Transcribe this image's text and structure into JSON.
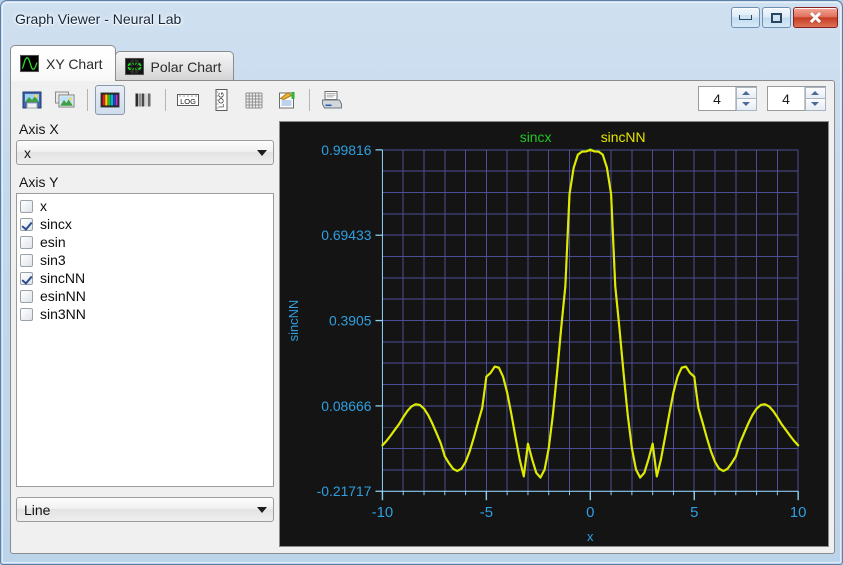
{
  "window": {
    "title": "Graph Viewer - Neural Lab",
    "controls": {
      "minimize": "Minimize",
      "restore": "Restore",
      "close": "Close"
    }
  },
  "tabs": [
    {
      "label": "XY Chart",
      "icon": "xy-chart-icon",
      "active": true
    },
    {
      "label": "Polar Chart",
      "icon": "polar-chart-icon",
      "active": false
    }
  ],
  "toolbar": {
    "buttons": [
      {
        "name": "save-image-icon",
        "title": "Save Image"
      },
      {
        "name": "copy-image-icon",
        "title": "Copy Image"
      },
      {
        "name": "color-chart-icon",
        "title": "Color Chart",
        "pressed": true
      },
      {
        "name": "gray-chart-icon",
        "title": "Grayscale Chart",
        "pressed": false
      },
      {
        "name": "log-x-icon",
        "title": "LOG X"
      },
      {
        "name": "log-y-icon",
        "title": "LOG Y"
      },
      {
        "name": "grid-icon",
        "title": "Grid"
      },
      {
        "name": "annotate-icon",
        "title": "Annotate"
      },
      {
        "name": "print-icon",
        "title": "Print"
      }
    ],
    "spinner_left": "4",
    "spinner_right": "4"
  },
  "sidebar": {
    "axis_x_label": "Axis X",
    "axis_x_value": "x",
    "axis_y_label": "Axis Y",
    "series": [
      {
        "label": "x",
        "checked": false
      },
      {
        "label": "sincx",
        "checked": true
      },
      {
        "label": "esin",
        "checked": false
      },
      {
        "label": "sin3",
        "checked": false
      },
      {
        "label": "sincNN",
        "checked": true
      },
      {
        "label": "esinNN",
        "checked": false
      },
      {
        "label": "sin3NN",
        "checked": false
      }
    ],
    "style_value": "Line"
  },
  "colors": {
    "plot_background": "#141414",
    "grid": "#4e4e96",
    "axis_text": "#2f9fe0",
    "series_sincx": "#22c522",
    "series_sincNN": "#e6e600"
  },
  "chart_data": {
    "type": "line",
    "title": "",
    "xlabel": "x",
    "ylabel": "sincNN",
    "xlim": [
      -10,
      10
    ],
    "ylim": [
      -0.21717,
      0.99816
    ],
    "xticks": [
      "-10",
      "-5",
      "0",
      "5",
      "10"
    ],
    "xtick_values": [
      -10,
      -5,
      0,
      5,
      10
    ],
    "yticks": [
      "-0.21717",
      "0.08666",
      "0.3905",
      "0.69433",
      "0.99816"
    ],
    "ytick_values": [
      -0.21717,
      0.08666,
      0.3905,
      0.69433,
      0.99816
    ],
    "grid": true,
    "legend_position": "top-center",
    "series": [
      {
        "name": "sincx",
        "color": "#22c522",
        "function": "sinc",
        "x": [
          -10,
          -9.8,
          -9.6,
          -9.4,
          -9.2,
          -9,
          -8.8,
          -8.6,
          -8.4,
          -8.2,
          -8,
          -7.8,
          -7.6,
          -7.4,
          -7.2,
          -7,
          -6.8,
          -6.6,
          -6.4,
          -6.2,
          -6,
          -5.8,
          -5.6,
          -5.4,
          -5.2,
          -5,
          -4.8,
          -4.6,
          -4.4,
          -4.2,
          -4,
          -3.8,
          -3.6,
          -3.4,
          -3.2,
          -3,
          -2.8,
          -2.6,
          -2.4,
          -2.2,
          -2,
          -1.8,
          -1.6,
          -1.4,
          -1.2,
          -1,
          -0.8,
          -0.6,
          -0.4,
          -0.2,
          0,
          0.2,
          0.4,
          0.6,
          0.8,
          1,
          1.2,
          1.4,
          1.6,
          1.8,
          2,
          2.2,
          2.4,
          2.6,
          2.8,
          3,
          3.2,
          3.4,
          3.6,
          3.8,
          4,
          4.2,
          4.4,
          4.6,
          4.8,
          5,
          5.2,
          5.4,
          5.6,
          5.8,
          6,
          6.2,
          6.4,
          6.6,
          6.8,
          7,
          7.2,
          7.4,
          7.6,
          7.8,
          8,
          8.2,
          8.4,
          8.6,
          8.8,
          9,
          9.2,
          9.4,
          9.6,
          9.8,
          10
        ],
        "y": [
          -0.0544,
          -0.0384,
          -0.0191,
          0.0013,
          0.0211,
          0.0458,
          0.0679,
          0.0841,
          0.0917,
          0.0893,
          0.0761,
          0.0535,
          0.0234,
          -0.0108,
          -0.0459,
          -0.0939,
          -0.1178,
          -0.1381,
          -0.1456,
          -0.1378,
          -0.1136,
          -0.0748,
          -0.0259,
          0.0274,
          0.0784,
          0.1918,
          0.2046,
          0.2273,
          0.2236,
          0.1922,
          0.1351,
          0.0591,
          -0.0247,
          -0.1036,
          -0.1648,
          -0.047,
          -0.1038,
          -0.1519,
          -0.1691,
          -0.1412,
          -0.0648,
          0.0541,
          0.2032,
          0.3636,
          0.5127,
          0.8415,
          0.9354,
          0.9816,
          0.9927,
          0.9933,
          1.0,
          0.9933,
          0.9927,
          0.9816,
          0.9354,
          0.8415,
          0.5127,
          0.3636,
          0.2032,
          0.0541,
          -0.0648,
          -0.1412,
          -0.1691,
          -0.1519,
          -0.1038,
          -0.047,
          -0.1648,
          -0.1036,
          -0.0247,
          0.0591,
          0.1351,
          0.1922,
          0.2236,
          0.2273,
          0.2046,
          0.1918,
          0.0784,
          0.0274,
          -0.0259,
          -0.0748,
          -0.1136,
          -0.1378,
          -0.1456,
          -0.1381,
          -0.1178,
          -0.0939,
          -0.0459,
          -0.0108,
          0.0234,
          0.0535,
          0.0761,
          0.0893,
          0.0917,
          0.0841,
          0.0679,
          0.0458,
          0.0211,
          0.0013,
          -0.0191,
          -0.0384,
          -0.0544
        ]
      },
      {
        "name": "sincNN",
        "color": "#e6e600",
        "function": "sinc-neural-net-approximation",
        "x": [
          -10,
          -9.8,
          -9.6,
          -9.4,
          -9.2,
          -9,
          -8.8,
          -8.6,
          -8.4,
          -8.2,
          -8,
          -7.8,
          -7.6,
          -7.4,
          -7.2,
          -7,
          -6.8,
          -6.6,
          -6.4,
          -6.2,
          -6,
          -5.8,
          -5.6,
          -5.4,
          -5.2,
          -5,
          -4.8,
          -4.6,
          -4.4,
          -4.2,
          -4,
          -3.8,
          -3.6,
          -3.4,
          -3.2,
          -3,
          -2.8,
          -2.6,
          -2.4,
          -2.2,
          -2,
          -1.8,
          -1.6,
          -1.4,
          -1.2,
          -1,
          -0.8,
          -0.6,
          -0.4,
          -0.2,
          0,
          0.2,
          0.4,
          0.6,
          0.8,
          1,
          1.2,
          1.4,
          1.6,
          1.8,
          2,
          2.2,
          2.4,
          2.6,
          2.8,
          3,
          3.2,
          3.4,
          3.6,
          3.8,
          4,
          4.2,
          4.4,
          4.6,
          4.8,
          5,
          5.2,
          5.4,
          5.6,
          5.8,
          6,
          6.2,
          6.4,
          6.6,
          6.8,
          7,
          7.2,
          7.4,
          7.6,
          7.8,
          8,
          8.2,
          8.4,
          8.6,
          8.8,
          9,
          9.2,
          9.4,
          9.6,
          9.8,
          10
        ],
        "y": [
          -0.0534,
          -0.0374,
          -0.0181,
          0.0023,
          0.0221,
          0.0468,
          0.0689,
          0.0851,
          0.0927,
          0.0903,
          0.0771,
          0.0545,
          0.0244,
          -0.0098,
          -0.0449,
          -0.0929,
          -0.1168,
          -0.1371,
          -0.1446,
          -0.1368,
          -0.1126,
          -0.0738,
          -0.0249,
          0.0284,
          0.0794,
          0.1908,
          0.2036,
          0.2263,
          0.2226,
          0.1912,
          0.1341,
          0.0581,
          -0.0237,
          -0.1026,
          -0.1638,
          -0.048,
          -0.1028,
          -0.1509,
          -0.1681,
          -0.1402,
          -0.0638,
          0.0551,
          0.2042,
          0.3646,
          0.5137,
          0.8405,
          0.9344,
          0.9806,
          0.9917,
          0.9923,
          0.9982,
          0.9923,
          0.9917,
          0.9806,
          0.9344,
          0.8405,
          0.5137,
          0.3646,
          0.2042,
          0.0551,
          -0.0638,
          -0.1402,
          -0.1681,
          -0.1509,
          -0.1028,
          -0.048,
          -0.1638,
          -0.1026,
          -0.0237,
          0.0581,
          0.1341,
          0.1912,
          0.2226,
          0.2263,
          0.2036,
          0.1908,
          0.0794,
          0.0284,
          -0.0249,
          -0.0738,
          -0.1126,
          -0.1368,
          -0.1446,
          -0.1371,
          -0.1168,
          -0.0929,
          -0.0449,
          -0.0098,
          0.0244,
          0.0545,
          0.0771,
          0.0903,
          0.0927,
          0.0851,
          0.0689,
          0.0468,
          0.0221,
          0.0023,
          -0.0181,
          -0.0374,
          -0.0534
        ]
      }
    ],
    "legend": [
      {
        "name": "sincx",
        "color": "#22c522"
      },
      {
        "name": "sincNN",
        "color": "#e6e600"
      }
    ]
  }
}
